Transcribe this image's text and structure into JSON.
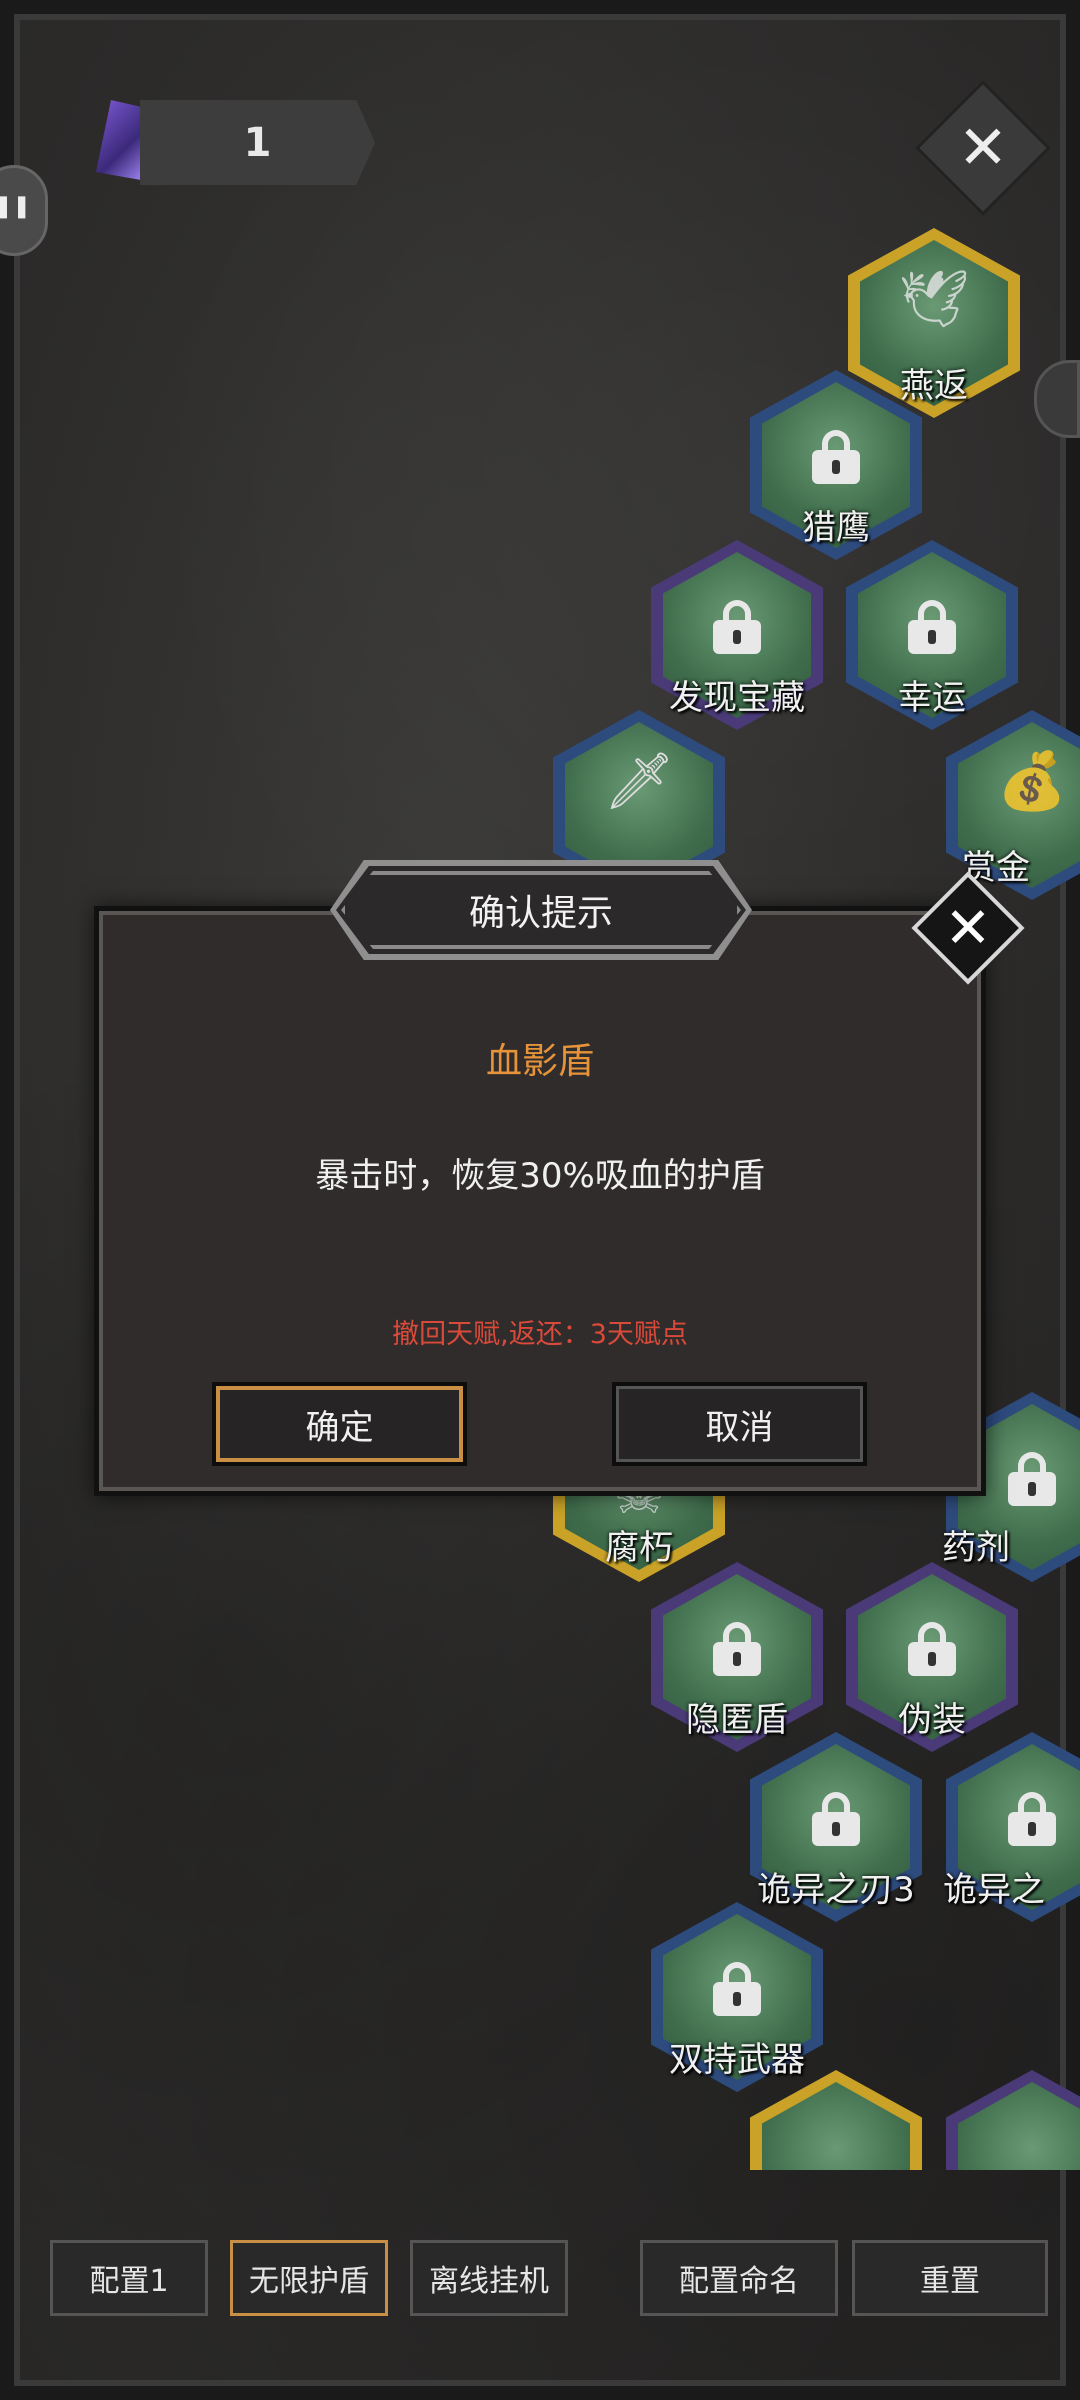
{
  "hud": {
    "gem_count": "1"
  },
  "talent_tree": {
    "nodes": [
      {
        "label": "燕返",
        "state": "unlocked",
        "icon": "swallow-icon"
      },
      {
        "label": "猎鹰",
        "state": "locked",
        "icon": "falcon-icon"
      },
      {
        "label": "发现宝藏",
        "state": "locked",
        "icon": "treasure-chest-icon"
      },
      {
        "label": "幸运",
        "state": "locked",
        "icon": "clover-icon"
      },
      {
        "label": "",
        "state": "unlocked",
        "icon": "bloody-knife-icon"
      },
      {
        "label": "赏金",
        "state": "unlocked",
        "icon": "money-bag-icon"
      },
      {
        "label": "腐朽",
        "state": "unlocked",
        "icon": "skull-icon"
      },
      {
        "label": "药剂",
        "state": "locked",
        "icon": "potion-icon"
      },
      {
        "label": "隐匿盾",
        "state": "locked",
        "icon": "shield-icon"
      },
      {
        "label": "伪装",
        "state": "locked",
        "icon": "mask-icon"
      },
      {
        "label": "诡异之刃3",
        "state": "locked",
        "icon": "crossed-blades-icon"
      },
      {
        "label": "诡异之",
        "state": "locked",
        "icon": "crossed-blades-icon"
      },
      {
        "label": "双持武器",
        "state": "locked",
        "icon": "dual-wield-icon"
      }
    ]
  },
  "dialog": {
    "title": "确认提示",
    "talent_name": "血影盾",
    "description": "暴击时，恢复30%吸血的护盾",
    "refund_note": "撤回天赋,返还：3天赋点",
    "confirm_label": "确定",
    "cancel_label": "取消"
  },
  "bottom_bar": {
    "config_label": "配置1",
    "preset_label": "无限护盾",
    "offline_label": "离线挂机",
    "rename_label": "配置命名",
    "reset_label": "重置"
  },
  "colors": {
    "accent_gold": "#c98f45",
    "talent_name": "#e6933a",
    "warning_red": "#d94a3a"
  }
}
